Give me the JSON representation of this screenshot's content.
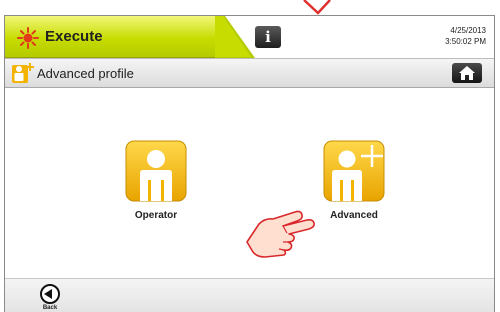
{
  "header": {
    "tab_label": "Execute",
    "tab_icon": "sun-icon",
    "info_button_icon": "info-icon",
    "info_symbol": "i",
    "date": "4/25/2013",
    "time": "3:50:02 PM"
  },
  "profile_bar": {
    "icon": "person-plus-icon",
    "title": "Advanced profile",
    "home_icon": "home-icon"
  },
  "profiles": [
    {
      "label": "Operator",
      "icon": "person-icon"
    },
    {
      "label": "Advanced",
      "icon": "person-plus-icon"
    }
  ],
  "footer": {
    "back_label": "Back",
    "back_icon": "arrow-left-circle-icon"
  },
  "colors": {
    "accent": "#c7dc00",
    "tile_yellow": "#f2b400",
    "pointer_red": "#d9282c"
  }
}
